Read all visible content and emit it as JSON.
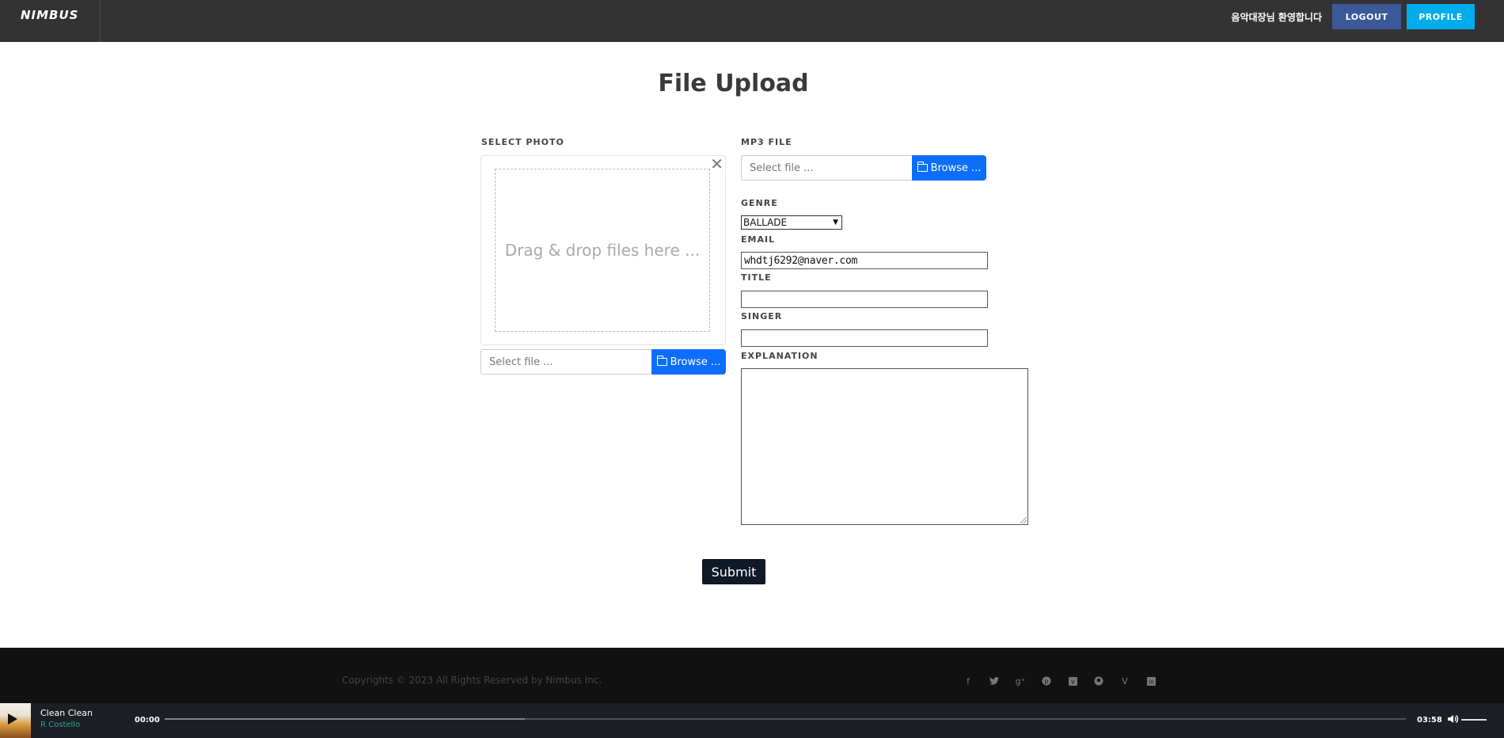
{
  "header": {
    "logo": "NIMBUS",
    "welcome": "음악대장님 환영합니다",
    "logout_label": "LOGOUT",
    "profile_label": "PROFILE"
  },
  "page": {
    "title": "File Upload"
  },
  "form": {
    "photo": {
      "label": "SELECT PHOTO",
      "drop_text": "Drag & drop files here ...",
      "file_placeholder": "Select file ...",
      "browse_label": "Browse ..."
    },
    "mp3": {
      "label": "MP3 FILE",
      "file_placeholder": "Select file ...",
      "browse_label": "Browse ..."
    },
    "genre": {
      "label": "GENRE",
      "value": "BALLADE"
    },
    "email": {
      "label": "EMAIL",
      "value": "whdtj6292@naver.com"
    },
    "title": {
      "label": "TITLE",
      "value": ""
    },
    "singer": {
      "label": "SINGER",
      "value": ""
    },
    "explanation": {
      "label": "EXPLANATION",
      "value": ""
    },
    "submit_label": "Submit"
  },
  "footer": {
    "copyright": "Copyrights © 2023 All Rights Reserved by Nimbus Inc.",
    "social_icons": [
      "facebook-icon",
      "twitter-icon",
      "google-plus-icon",
      "pinterest-icon",
      "vimeo-icon",
      "github-icon",
      "vine-icon",
      "linkedin-icon"
    ]
  },
  "player": {
    "track_title": "Clean Clean",
    "artist": "R Costello",
    "current_time": "00:00",
    "duration": "03:58",
    "buffered_fraction": 0.29
  },
  "colors": {
    "header_bg": "#333333",
    "logout_bg": "#3b5998",
    "profile_bg": "#00aced",
    "browse_bg": "#0d6efd",
    "submit_bg": "#111827",
    "footer_bg": "#111111",
    "player_bg": "#1c1f23",
    "artist_color": "#1ea69a"
  }
}
